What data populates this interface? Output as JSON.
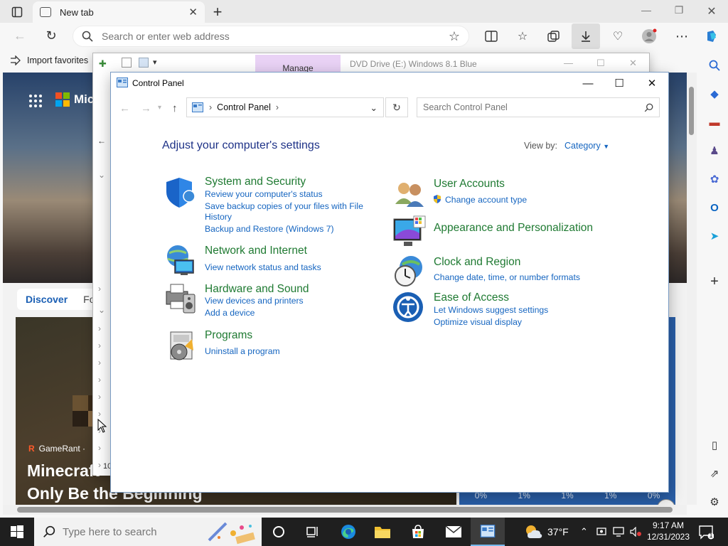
{
  "browser": {
    "tab_title": "New tab",
    "address_placeholder": "Search or enter web address",
    "favorites_bar_item": "Import favorites",
    "ms_brand_partial": "Mic",
    "feed": {
      "discover_tab": "Discover",
      "next_tab_partial": "Fo",
      "card_source": "GameRant ·",
      "card_source_letter": "R",
      "card_title_line1": "Minecraft",
      "card_title_line2": "Only Be the Beginning",
      "weather_values": [
        "0%",
        "1%",
        "1%",
        "1%",
        "0%"
      ]
    }
  },
  "explorer": {
    "manage_tab": "Manage",
    "title": "DVD Drive (E:) Windows 8.1 Blue",
    "ribbon_partial": "F",
    "status_partial": "10"
  },
  "control_panel": {
    "title": "Control Panel",
    "breadcrumb": "Control Panel",
    "search_placeholder": "Search Control Panel",
    "heading": "Adjust your computer's settings",
    "view_by_label": "View by:",
    "view_by_value": "Category",
    "categories_left": [
      {
        "title": "System and Security",
        "links": [
          "Review your computer's status",
          "Save backup copies of your files with File",
          "History",
          "Backup and Restore (Windows 7)"
        ]
      },
      {
        "title": "Network and Internet",
        "links": [
          "View network status and tasks"
        ]
      },
      {
        "title": "Hardware and Sound",
        "links": [
          "View devices and printers",
          "Add a device"
        ]
      },
      {
        "title": "Programs",
        "links": [
          "Uninstall a program"
        ]
      }
    ],
    "categories_right": [
      {
        "title": "User Accounts",
        "links": [
          "Change account type"
        ]
      },
      {
        "title": "Appearance and Personalization",
        "links": []
      },
      {
        "title": "Clock and Region",
        "links": [
          "Change date, time, or number formats"
        ]
      },
      {
        "title": "Ease of Access",
        "links": [
          "Let Windows suggest settings",
          "Optimize visual display"
        ]
      }
    ]
  },
  "taskbar": {
    "search_placeholder": "Type here to search",
    "weather_temp": "37°F",
    "time": "9:17 AM",
    "date": "12/31/2023",
    "notification_count": "1"
  },
  "colors": {
    "link_blue": "#1565c0",
    "category_green": "#1f7a32",
    "heading_navy": "#1e3287",
    "manage_purple": "#e9d2f5",
    "taskbar_dark": "#1f1f1f"
  }
}
